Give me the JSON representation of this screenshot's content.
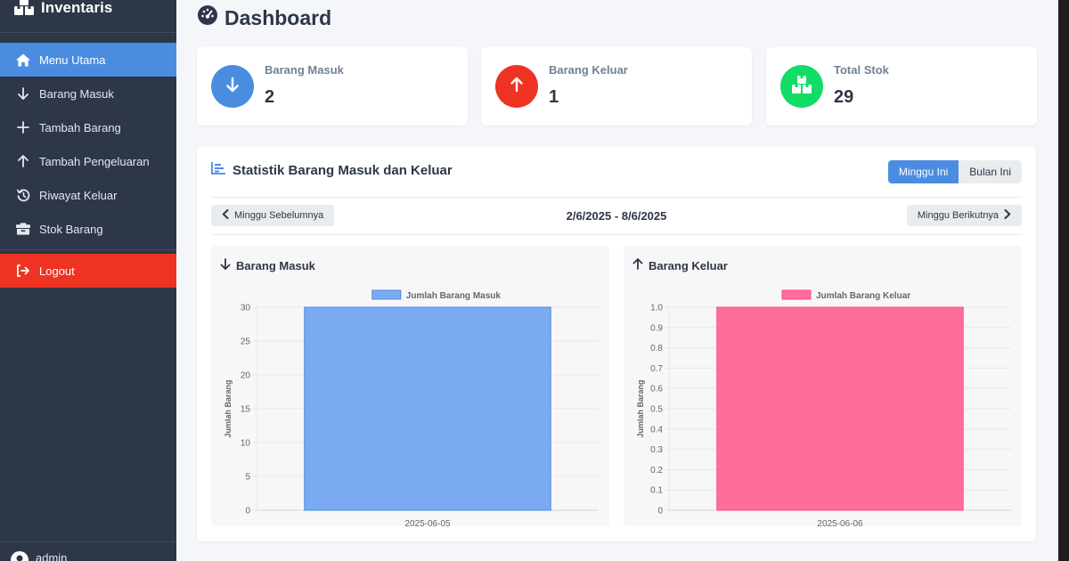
{
  "sidebar": {
    "brand": "Inventaris",
    "items": [
      {
        "label": "Menu Utama",
        "icon": "home-icon"
      },
      {
        "label": "Barang Masuk",
        "icon": "arrow-down-icon"
      },
      {
        "label": "Tambah Barang",
        "icon": "plus-icon"
      },
      {
        "label": "Tambah Pengeluaran",
        "icon": "arrow-up-icon"
      },
      {
        "label": "Riwayat Keluar",
        "icon": "history-icon"
      },
      {
        "label": "Stok Barang",
        "icon": "boxes-icon"
      }
    ],
    "logout": "Logout",
    "user": "admin"
  },
  "page": {
    "title": "Dashboard"
  },
  "stats": [
    {
      "label": "Barang Masuk",
      "value": "2",
      "color": "#4a8de0",
      "icon": "arrow-down-icon"
    },
    {
      "label": "Barang Keluar",
      "value": "1",
      "color": "#ee3322",
      "icon": "arrow-up-icon"
    },
    {
      "label": "Total Stok",
      "value": "29",
      "color": "#11dd66",
      "icon": "boxes-icon"
    }
  ],
  "panel": {
    "title": "Statistik Barang Masuk dan Keluar",
    "toggle": {
      "week": "Minggu Ini",
      "month": "Bulan Ini"
    },
    "prev": "Minggu Sebelumnya",
    "next": "Minggu Berikutnya",
    "date_range": "2/6/2025 - 8/6/2025"
  },
  "chart_data": [
    {
      "type": "bar",
      "title": "Barang Masuk",
      "categories": [
        "2025-06-05"
      ],
      "series": [
        {
          "name": "Jumlah Barang Masuk",
          "values": [
            30
          ]
        }
      ],
      "ylabel": "Jumlah Barang",
      "ylim": [
        0,
        30
      ],
      "yticks": [
        "0",
        "5",
        "10",
        "15",
        "20",
        "25",
        "30"
      ],
      "grid": true,
      "legend": "top-center",
      "color": "#7aabf0",
      "border_color": "#4a8de0"
    },
    {
      "type": "bar",
      "title": "Barang Keluar",
      "categories": [
        "2025-06-06"
      ],
      "series": [
        {
          "name": "Jumlah Barang Keluar",
          "values": [
            1.0
          ]
        }
      ],
      "ylabel": "Jumlah Barang",
      "ylim": [
        0,
        1.0
      ],
      "yticks": [
        "0",
        "0.1",
        "0.2",
        "0.3",
        "0.4",
        "0.5",
        "0.6",
        "0.7",
        "0.8",
        "0.9",
        "1.0"
      ],
      "grid": true,
      "legend": "top-center",
      "color": "#ff6d9a",
      "border_color": "#ff4d85"
    }
  ]
}
